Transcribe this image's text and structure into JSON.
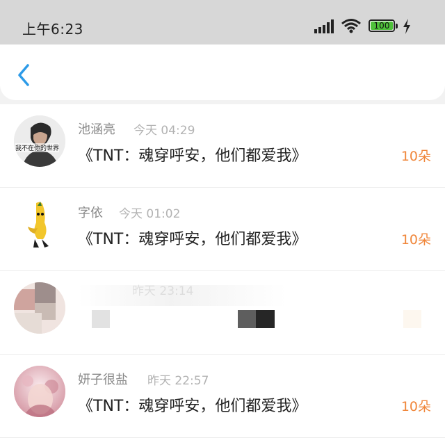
{
  "status_bar": {
    "time": "上午6:23",
    "battery": "100",
    "icons": [
      "signal-icon",
      "wifi-icon",
      "battery-icon",
      "charging-icon"
    ]
  },
  "header": {
    "back_icon": "chevron-left-icon",
    "accent_color": "#2d9be8"
  },
  "gift_list": [
    {
      "name": "池涵亮",
      "time": "今天 04:29",
      "book": "《TNT：魂穿呼安，他们都爱我》",
      "amount": "10朵",
      "avatar_caption": "我不在你的世界"
    },
    {
      "name": "字依",
      "time": "今天 01:02",
      "book": "《TNT：魂穿呼安，他们都爱我》",
      "amount": "10朵"
    },
    {
      "name": "",
      "time": "昨天 23:14",
      "book": "",
      "amount": "",
      "pixelated": true
    },
    {
      "name": "妍子很盐",
      "time": "昨天 22:57",
      "book": "《TNT：魂穿呼安，他们都爱我》",
      "amount": "10朵"
    }
  ],
  "colors": {
    "amount": "#f0863a",
    "status_bar_bg": "#d7d7d7",
    "battery_green": "#4fc13b"
  }
}
